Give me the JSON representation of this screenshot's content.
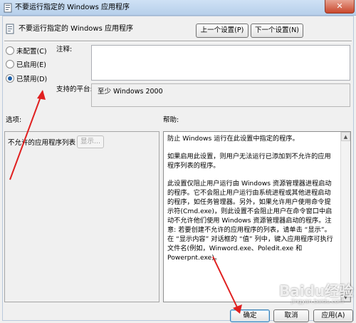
{
  "window": {
    "title": "不要运行指定的 Windows 应用程序",
    "close_glyph": "✕"
  },
  "header": {
    "policy_name": "不要运行指定的 Windows 应用程序",
    "prev_button": "上一个设置(P)",
    "next_button": "下一个设置(N)"
  },
  "state": {
    "options": [
      {
        "label": "未配置(C)",
        "checked": false
      },
      {
        "label": "已启用(E)",
        "checked": false
      },
      {
        "label": "已禁用(D)",
        "checked": true
      }
    ]
  },
  "comment": {
    "label": "注释:",
    "value": ""
  },
  "platform": {
    "label": "支持的平台:",
    "value": "至少 Windows 2000"
  },
  "options_section": {
    "label": "选项:",
    "disallowed_list_label": "不允许的应用程序列表",
    "show_button": "显示..."
  },
  "help_section": {
    "label": "帮助:",
    "paragraphs": [
      "防止 Windows 运行在此设置中指定的程序。",
      "如果启用此设置，则用户无法运行已添加到不允许的应用程序列表的程序。",
      "此设置仅阻止用户运行由 Windows 资源管理器进程启动的程序。它不会阻止用户运行由系统进程或其他进程启动的程序，如任务管理器。另外，如果允许用户使用命令提示符(Cmd.exe)，则此设置不会阻止用户在命令窗口中启动不允许他们使用 Windows 资源管理器启动的程序。注意: 若要创建不允许的应用程序的列表，请单击 “显示”。在 “显示内容” 对话框的 “值” 列中，键入应用程序可执行文件名(例如，Winword.exe、Poledit.exe 和 Powerpnt.exe)。"
    ]
  },
  "footer": {
    "ok_button": "确定",
    "cancel_button": "取消",
    "apply_button": "应用(A)"
  },
  "watermark": {
    "text": "Baidu经验",
    "sub": "jingyan.baidu.com"
  },
  "colors": {
    "annotation_arrow": "#e02020",
    "radio_dot": "#1d5fa8",
    "titlebar": "#cfe1f5"
  },
  "icons": {
    "title": "policy-doc-icon",
    "header": "policy-doc-icon",
    "close": "close-icon"
  }
}
